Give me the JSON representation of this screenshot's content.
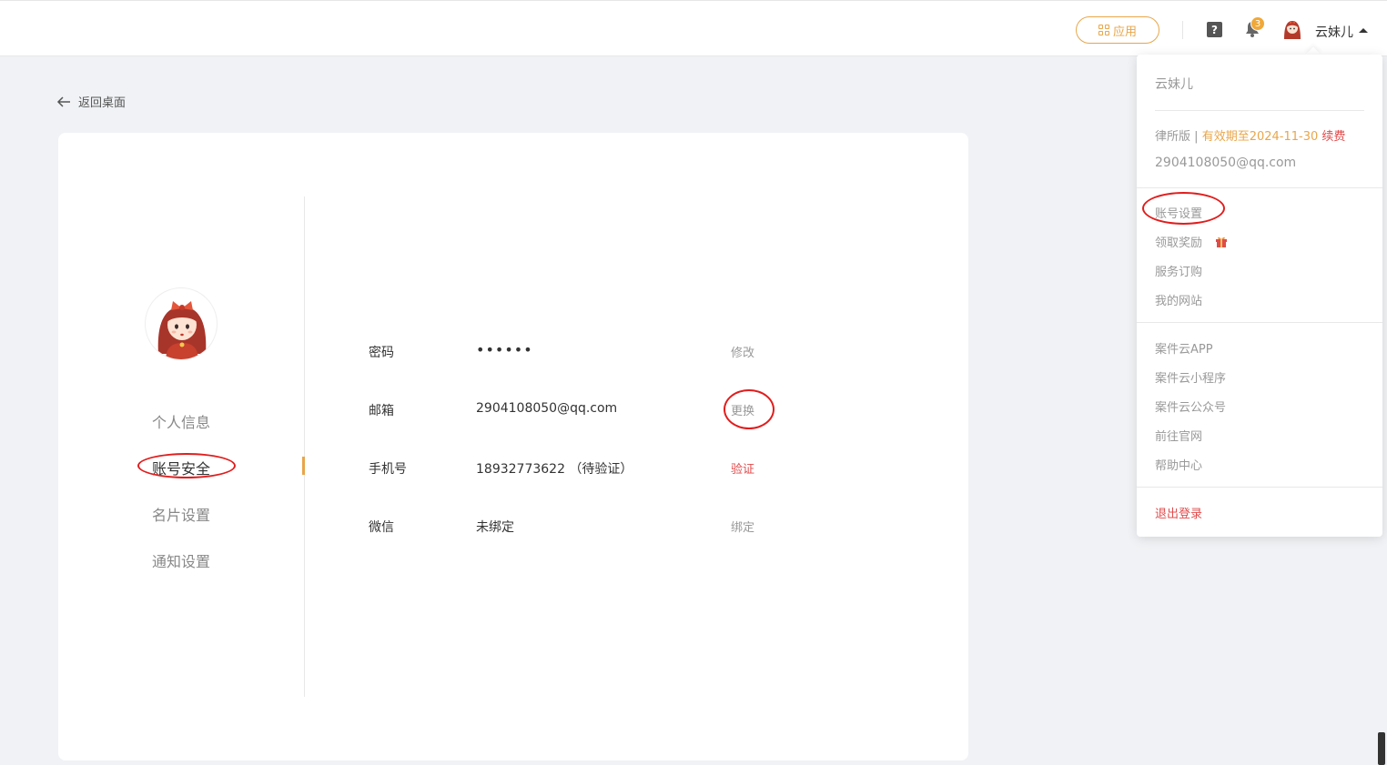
{
  "header": {
    "apps_label": "应用",
    "help_glyph": "?",
    "bell_count": "3",
    "user_name": "云妹儿"
  },
  "back": {
    "label": "返回桌面"
  },
  "sidebar": {
    "items": [
      {
        "label": "个人信息"
      },
      {
        "label": "账号安全"
      },
      {
        "label": "名片设置"
      },
      {
        "label": "通知设置"
      }
    ]
  },
  "security": {
    "rows": [
      {
        "label": "密码",
        "value": "••••••",
        "action": "修改"
      },
      {
        "label": "邮箱",
        "value": "2904108050@qq.com",
        "action": "更换"
      },
      {
        "label": "手机号",
        "value": "18932773622 （待验证）",
        "action": "验证"
      },
      {
        "label": "微信",
        "value": "未绑定",
        "action": "绑定"
      }
    ]
  },
  "dropdown": {
    "name": "云妹儿",
    "edition": "律所版",
    "pipe": "|",
    "expiry": "有效期至2024-11-30",
    "renew": "续费",
    "email": "2904108050@qq.com",
    "group1": [
      "账号设置",
      "领取奖励",
      "服务订购",
      "我的网站"
    ],
    "group2": [
      "案件云APP",
      "案件云小程序",
      "案件云公众号",
      "前往官网",
      "帮助中心"
    ],
    "logout": "退出登录"
  },
  "colors": {
    "accent": "#e8a64a",
    "danger": "#e04b4b",
    "annotation": "#e11d1d"
  }
}
